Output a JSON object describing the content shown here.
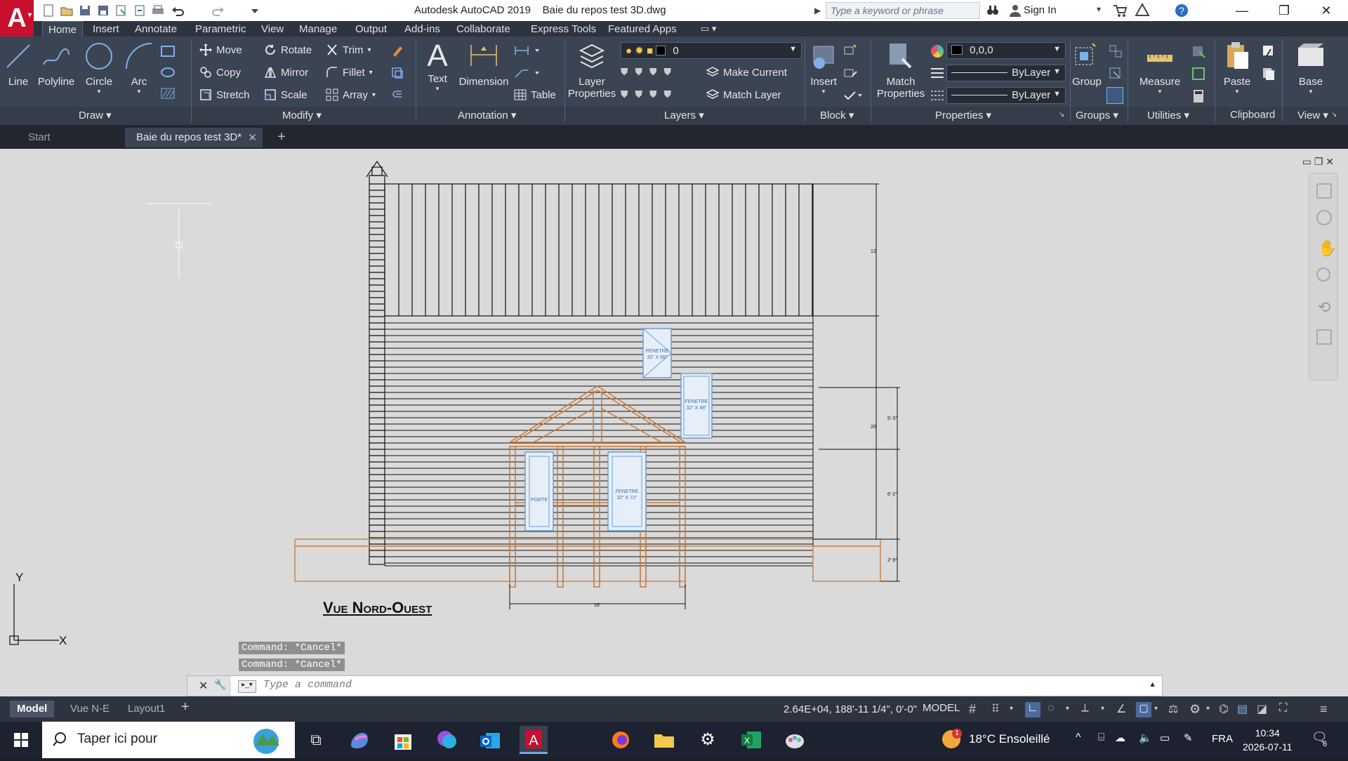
{
  "titlebar": {
    "app_title": "Autodesk AutoCAD 2019",
    "file_name": "Baie du repos test 3D.dwg",
    "search_placeholder": "Type a keyword or phrase",
    "signin": "Sign In"
  },
  "ribbon_tabs": [
    "Home",
    "Insert",
    "Annotate",
    "Parametric",
    "View",
    "Manage",
    "Output",
    "Add-ins",
    "Collaborate",
    "Express Tools",
    "Featured Apps"
  ],
  "ribbon": {
    "draw": {
      "title": "Draw",
      "line": "Line",
      "polyline": "Polyline",
      "circle": "Circle",
      "arc": "Arc"
    },
    "modify": {
      "title": "Modify",
      "move": "Move",
      "rotate": "Rotate",
      "trim": "Trim",
      "copy": "Copy",
      "mirror": "Mirror",
      "fillet": "Fillet",
      "stretch": "Stretch",
      "scale": "Scale",
      "array": "Array"
    },
    "annotation": {
      "title": "Annotation",
      "text": "Text",
      "dimension": "Dimension",
      "table": "Table"
    },
    "layers": {
      "title": "Layers",
      "layer_properties_1": "Layer",
      "layer_properties_2": "Properties",
      "current_layer": "0",
      "make_current": "Make Current",
      "match_layer": "Match Layer"
    },
    "block": {
      "title": "Block",
      "insert": "Insert"
    },
    "properties": {
      "title": "Properties",
      "match_1": "Match",
      "match_2": "Properties",
      "color": "0,0,0",
      "linetype": "ByLayer",
      "lineweight": "ByLayer"
    },
    "groups": {
      "title": "Groups",
      "group": "Group"
    },
    "utilities": {
      "title": "Utilities",
      "measure": "Measure"
    },
    "clipboard": {
      "title": "Clipboard",
      "paste": "Paste"
    },
    "view": {
      "title": "View",
      "base": "Base"
    }
  },
  "doc_tabs": {
    "start": "Start",
    "active": "Baie du repos test 3D*"
  },
  "drawing": {
    "view_title": "Vue Nord-Ouest",
    "dim_upper": "12'",
    "dim_total": "20'",
    "dim_a": "5'-3\"",
    "dim_b": "6'-2\"",
    "dim_c": "2'-9\"",
    "dim_bottom": "16'",
    "win_label_1": "FENETRE",
    "win_label_2": "32\" X 56\"",
    "win_label_3": "FENETRE",
    "win_label_4": "32\" X 48\"",
    "door_label": "PORTE",
    "win_label_5": "FENETRE",
    "win_label_6": "32\" X 72\""
  },
  "command": {
    "history": [
      "Command: *Cancel*",
      "Command: *Cancel*"
    ],
    "placeholder": "Type a command"
  },
  "statusbar": {
    "layout_tabs": [
      "Model",
      "Vue N-E",
      "Layout1"
    ],
    "coords": "2.64E+04, 188'-11 1/4\", 0'-0\"",
    "space": "MODEL"
  },
  "taskbar": {
    "search_placeholder": "Taper ici pour",
    "weather": "18°C  Ensoleillé",
    "weather_badge": "1",
    "lang": "FRA",
    "time": "10:34",
    "date": "2026-07-11",
    "notif_count": "6"
  },
  "colors": {
    "accent_red": "#c8102e",
    "ribbon_bg": "#3b4453",
    "canvas_bg": "#dadada",
    "porch_orange": "#c87a3a",
    "window_blue": "#6aa0d8"
  }
}
